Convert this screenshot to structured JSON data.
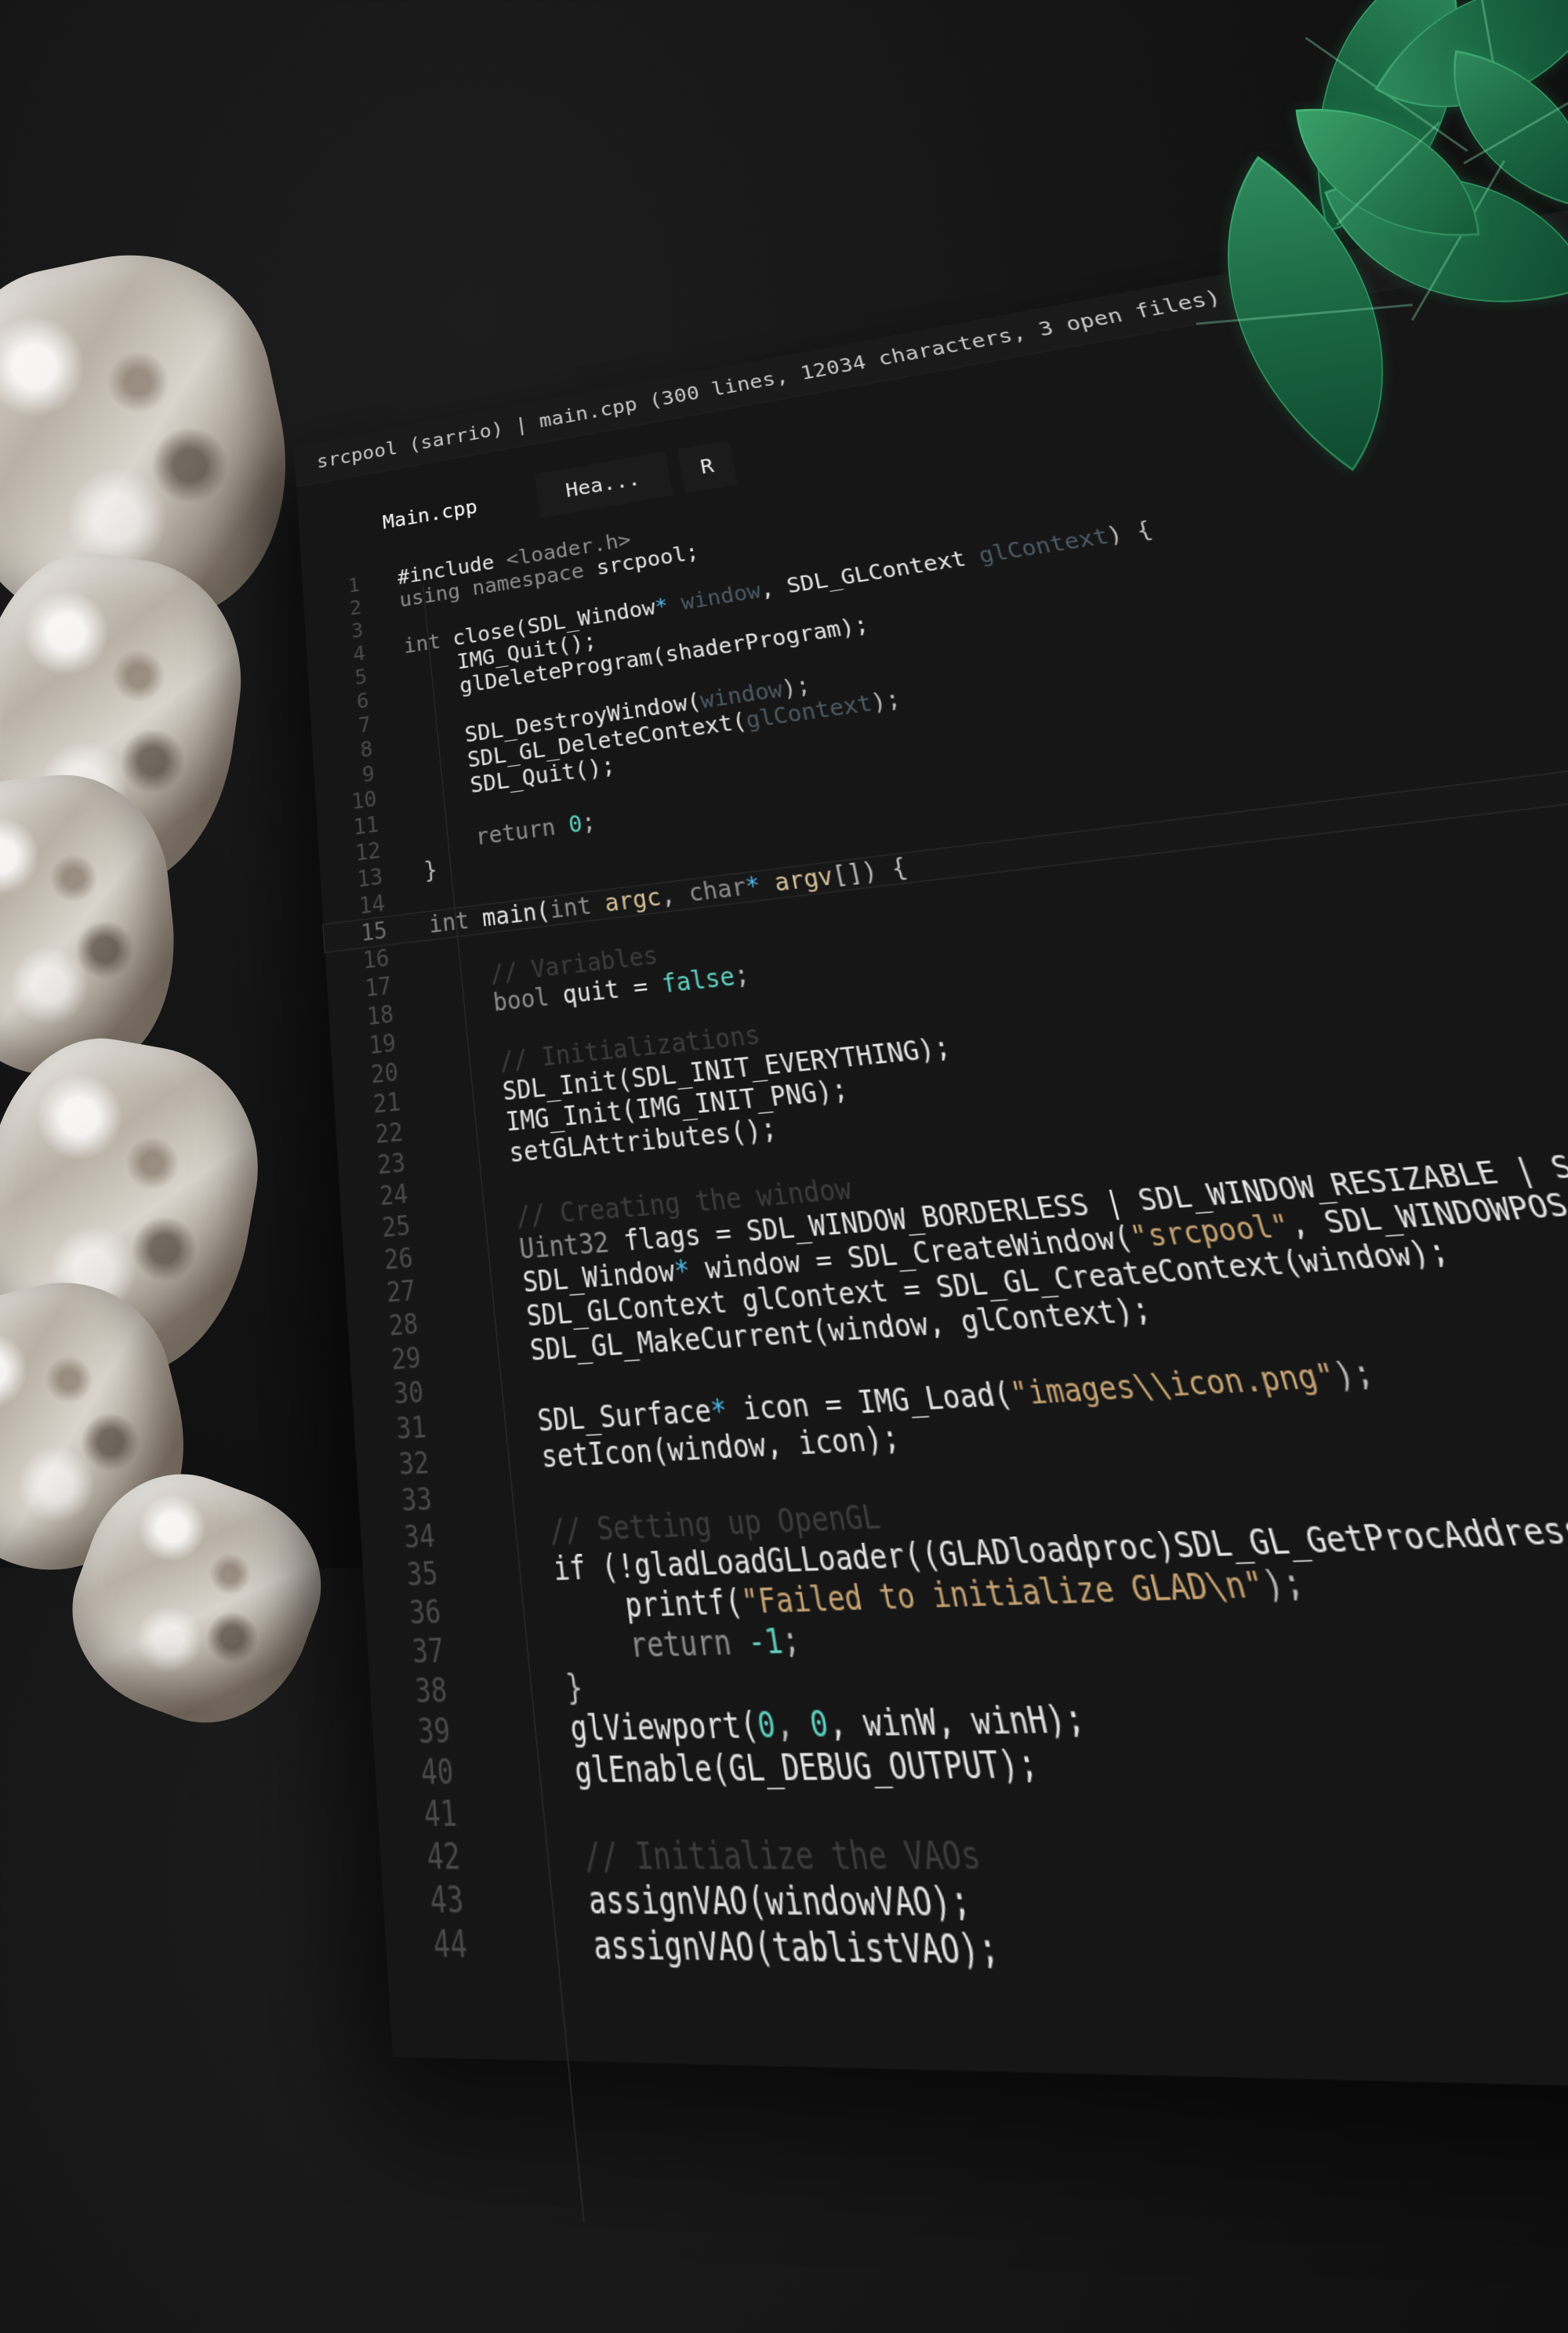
{
  "window": {
    "title": "srcpool (sarrio) | main.cpp (300 lines, 12034 characters, 3 open files)"
  },
  "tabs": [
    {
      "label": "Main.cpp",
      "active": true
    },
    {
      "label": "Hea...",
      "active": false
    },
    {
      "label": "R",
      "active": false
    }
  ],
  "editor": {
    "current_line": 15,
    "lines": [
      {
        "n": "1",
        "indent": 0,
        "tokens": [
          {
            "t": "#include ",
            "c": "fn"
          },
          {
            "t": "<loader.h>",
            "c": "kw"
          }
        ]
      },
      {
        "n": "2",
        "indent": 0,
        "tokens": [
          {
            "t": "using namespace ",
            "c": "kw"
          },
          {
            "t": "srcpool;",
            "c": "fn"
          }
        ]
      },
      {
        "n": "3",
        "indent": 0,
        "tokens": []
      },
      {
        "n": "4",
        "indent": 0,
        "tokens": [
          {
            "t": "int ",
            "c": "kw"
          },
          {
            "t": "close(SDL_Window",
            "c": "fn"
          },
          {
            "t": "*",
            "c": "ptr"
          },
          {
            "t": " window",
            "c": "param"
          },
          {
            "t": ", SDL_GLContext ",
            "c": "fn"
          },
          {
            "t": "glContext",
            "c": "param"
          },
          {
            "t": ") {",
            "c": "punc"
          }
        ]
      },
      {
        "n": "5",
        "indent": 4,
        "tokens": [
          {
            "t": "IMG_Quit();",
            "c": "fn"
          }
        ]
      },
      {
        "n": "6",
        "indent": 4,
        "tokens": [
          {
            "t": "glDeleteProgram(shaderProgram);",
            "c": "fn"
          }
        ]
      },
      {
        "n": "7",
        "indent": 0,
        "tokens": []
      },
      {
        "n": "8",
        "indent": 4,
        "tokens": [
          {
            "t": "SDL_DestroyWindow(",
            "c": "fn"
          },
          {
            "t": "window",
            "c": "param"
          },
          {
            "t": ");",
            "c": "punc"
          }
        ]
      },
      {
        "n": "9",
        "indent": 4,
        "tokens": [
          {
            "t": "SDL_GL_DeleteContext(",
            "c": "fn"
          },
          {
            "t": "glContext",
            "c": "param"
          },
          {
            "t": ");",
            "c": "punc"
          }
        ]
      },
      {
        "n": "10",
        "indent": 4,
        "tokens": [
          {
            "t": "SDL_Quit();",
            "c": "fn"
          }
        ]
      },
      {
        "n": "11",
        "indent": 0,
        "tokens": []
      },
      {
        "n": "12",
        "indent": 4,
        "tokens": [
          {
            "t": "return ",
            "c": "kw"
          },
          {
            "t": "0",
            "c": "num"
          },
          {
            "t": ";",
            "c": "punc"
          }
        ]
      },
      {
        "n": "13",
        "indent": 0,
        "tokens": [
          {
            "t": "}",
            "c": "punc"
          }
        ]
      },
      {
        "n": "14",
        "indent": 0,
        "tokens": []
      },
      {
        "n": "15",
        "indent": 0,
        "tokens": [
          {
            "t": "int ",
            "c": "kw"
          },
          {
            "t": "main(",
            "c": "fn"
          },
          {
            "t": "int ",
            "c": "kw"
          },
          {
            "t": "argc",
            "c": "arg"
          },
          {
            "t": ", ",
            "c": "punc"
          },
          {
            "t": "char",
            "c": "kw"
          },
          {
            "t": "*",
            "c": "ptr"
          },
          {
            "t": " argv",
            "c": "arg"
          },
          {
            "t": "[]) {",
            "c": "punc"
          }
        ]
      },
      {
        "n": "16",
        "indent": 0,
        "tokens": []
      },
      {
        "n": "17",
        "indent": 4,
        "tokens": [
          {
            "t": "// Variables",
            "c": "cm"
          }
        ]
      },
      {
        "n": "18",
        "indent": 4,
        "tokens": [
          {
            "t": "bool ",
            "c": "kw"
          },
          {
            "t": "quit = ",
            "c": "fn"
          },
          {
            "t": "false",
            "c": "num"
          },
          {
            "t": ";",
            "c": "punc"
          }
        ]
      },
      {
        "n": "19",
        "indent": 0,
        "tokens": []
      },
      {
        "n": "20",
        "indent": 4,
        "tokens": [
          {
            "t": "// Initializations",
            "c": "cm"
          }
        ]
      },
      {
        "n": "21",
        "indent": 4,
        "tokens": [
          {
            "t": "SDL_Init(SDL_INIT_EVERYTHING);",
            "c": "fn"
          }
        ]
      },
      {
        "n": "22",
        "indent": 4,
        "tokens": [
          {
            "t": "IMG_Init(IMG_INIT_PNG);",
            "c": "fn"
          }
        ]
      },
      {
        "n": "23",
        "indent": 4,
        "tokens": [
          {
            "t": "setGLAttributes();",
            "c": "fn"
          }
        ]
      },
      {
        "n": "24",
        "indent": 0,
        "tokens": []
      },
      {
        "n": "25",
        "indent": 4,
        "tokens": [
          {
            "t": "// Creating the window",
            "c": "cm"
          }
        ]
      },
      {
        "n": "26",
        "indent": 4,
        "tokens": [
          {
            "t": "Uint32 ",
            "c": "kw"
          },
          {
            "t": "flags = SDL_WINDOW_BORDERLESS | SDL_WINDOW_RESIZABLE | SDL_WINDOW_OPENGL;",
            "c": "fn"
          }
        ]
      },
      {
        "n": "27",
        "indent": 4,
        "tokens": [
          {
            "t": "SDL_Window",
            "c": "fn"
          },
          {
            "t": "*",
            "c": "ptr"
          },
          {
            "t": " window = SDL_CreateWindow(",
            "c": "fn"
          },
          {
            "t": "\"srcpool\"",
            "c": "str"
          },
          {
            "t": ", SDL_WINDOWPOS_CENTERED, SDL_WINDOWPOS_C",
            "c": "fn"
          }
        ]
      },
      {
        "n": "28",
        "indent": 4,
        "tokens": [
          {
            "t": "SDL_GLContext glContext = SDL_GL_CreateContext(window);",
            "c": "fn"
          }
        ]
      },
      {
        "n": "29",
        "indent": 4,
        "tokens": [
          {
            "t": "SDL_GL_MakeCurrent(window, glContext);",
            "c": "fn"
          }
        ]
      },
      {
        "n": "30",
        "indent": 0,
        "tokens": []
      },
      {
        "n": "31",
        "indent": 4,
        "tokens": [
          {
            "t": "SDL_Surface",
            "c": "fn"
          },
          {
            "t": "*",
            "c": "ptr"
          },
          {
            "t": " icon = IMG_Load(",
            "c": "fn"
          },
          {
            "t": "\"images\\\\icon.png\"",
            "c": "str"
          },
          {
            "t": ");",
            "c": "punc"
          }
        ]
      },
      {
        "n": "32",
        "indent": 4,
        "tokens": [
          {
            "t": "setIcon(window, icon);",
            "c": "fn"
          }
        ]
      },
      {
        "n": "33",
        "indent": 0,
        "tokens": []
      },
      {
        "n": "34",
        "indent": 4,
        "tokens": [
          {
            "t": "// Setting up OpenGL",
            "c": "cm"
          }
        ]
      },
      {
        "n": "35",
        "indent": 4,
        "tokens": [
          {
            "t": "if (!gladLoadGLLoader((GLADloadproc)SDL_GL_GetProcAddress)) {",
            "c": "fn"
          }
        ]
      },
      {
        "n": "36",
        "indent": 8,
        "tokens": [
          {
            "t": "printf(",
            "c": "fn"
          },
          {
            "t": "\"Failed to initialize GLAD\\n\"",
            "c": "str"
          },
          {
            "t": ");",
            "c": "punc"
          }
        ]
      },
      {
        "n": "37",
        "indent": 8,
        "tokens": [
          {
            "t": "return ",
            "c": "kw"
          },
          {
            "t": "-1",
            "c": "num"
          },
          {
            "t": ";",
            "c": "punc"
          }
        ]
      },
      {
        "n": "38",
        "indent": 4,
        "tokens": [
          {
            "t": "}",
            "c": "punc"
          }
        ]
      },
      {
        "n": "39",
        "indent": 4,
        "tokens": [
          {
            "t": "glViewport(",
            "c": "fn"
          },
          {
            "t": "0",
            "c": "num"
          },
          {
            "t": ", ",
            "c": "punc"
          },
          {
            "t": "0",
            "c": "num"
          },
          {
            "t": ", winW, winH);",
            "c": "fn"
          }
        ]
      },
      {
        "n": "40",
        "indent": 4,
        "tokens": [
          {
            "t": "glEnable(GL_DEBUG_OUTPUT);",
            "c": "fn"
          }
        ]
      },
      {
        "n": "41",
        "indent": 0,
        "tokens": []
      },
      {
        "n": "42",
        "indent": 4,
        "tokens": [
          {
            "t": "// Initialize the VAOs",
            "c": "cm"
          }
        ]
      },
      {
        "n": "43",
        "indent": 4,
        "tokens": [
          {
            "t": "assignVAO(windowVAO);",
            "c": "fn"
          }
        ]
      },
      {
        "n": "44",
        "indent": 4,
        "tokens": [
          {
            "t": "assignVAO(tablistVAO);",
            "c": "fn"
          }
        ]
      }
    ]
  },
  "colors": {
    "background": "#141414",
    "editor_bg": "#161616",
    "number": "#5fd2c3",
    "string": "#c9a574",
    "pointer": "#4fb6e8",
    "argument": "#d6c29a",
    "mint_green": "#1c6a45"
  }
}
